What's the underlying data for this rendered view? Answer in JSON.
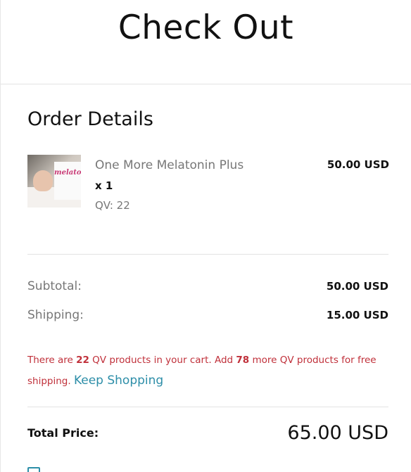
{
  "header": {
    "title": "Check Out"
  },
  "order": {
    "section_title": "Order Details",
    "item": {
      "thumbnail_icon": "product-thumbnail",
      "brand_text": "melatonin",
      "name": "One More Melatonin Plus",
      "qty": "x 1",
      "qv": "QV: 22",
      "price": "50.00 USD"
    }
  },
  "summary": {
    "subtotal_label": "Subtotal:",
    "subtotal_value": "50.00 USD",
    "shipping_label": "Shipping:",
    "shipping_value": "15.00 USD"
  },
  "notice": {
    "part1": "There are ",
    "qv_count": "22",
    "part2": " QV products in your cart. Add ",
    "qv_needed": "78",
    "part3": " more QV products for free shipping. ",
    "link_label": "Keep Shopping",
    "color": "#c0303a",
    "link_color": "#2d8ea8"
  },
  "total": {
    "label": "Total Price:",
    "value": "65.00 USD"
  }
}
